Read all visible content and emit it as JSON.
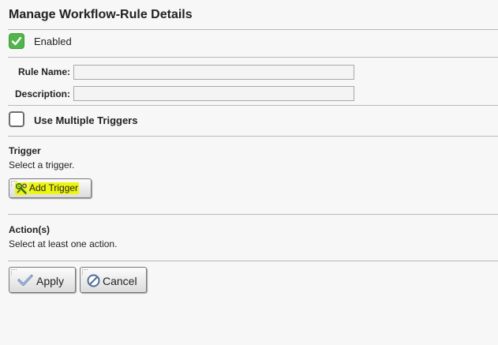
{
  "page": {
    "title": "Manage Workflow-Rule Details"
  },
  "enabled": {
    "label": "Enabled",
    "checked": true
  },
  "form": {
    "rule_name_label": "Rule Name:",
    "rule_name_value": "",
    "description_label": "Description:",
    "description_value": ""
  },
  "multiple_triggers": {
    "label": "Use Multiple Triggers",
    "checked": false
  },
  "trigger": {
    "heading": "Trigger",
    "hint": "Select a trigger.",
    "add_button_label": "Add Trigger",
    "add_button_icon": "wrench-gear-icon",
    "highlight_color": "#eef50f"
  },
  "actions": {
    "heading": "Action(s)",
    "hint": "Select at least one action."
  },
  "footer": {
    "apply_label": "Apply",
    "apply_icon": "checkmark-icon",
    "cancel_label": "Cancel",
    "cancel_icon": "cancel-circle-icon"
  },
  "colors": {
    "check_green": "#52b54b",
    "background": "#f7f7f7",
    "divider": "#b9b9b9"
  }
}
